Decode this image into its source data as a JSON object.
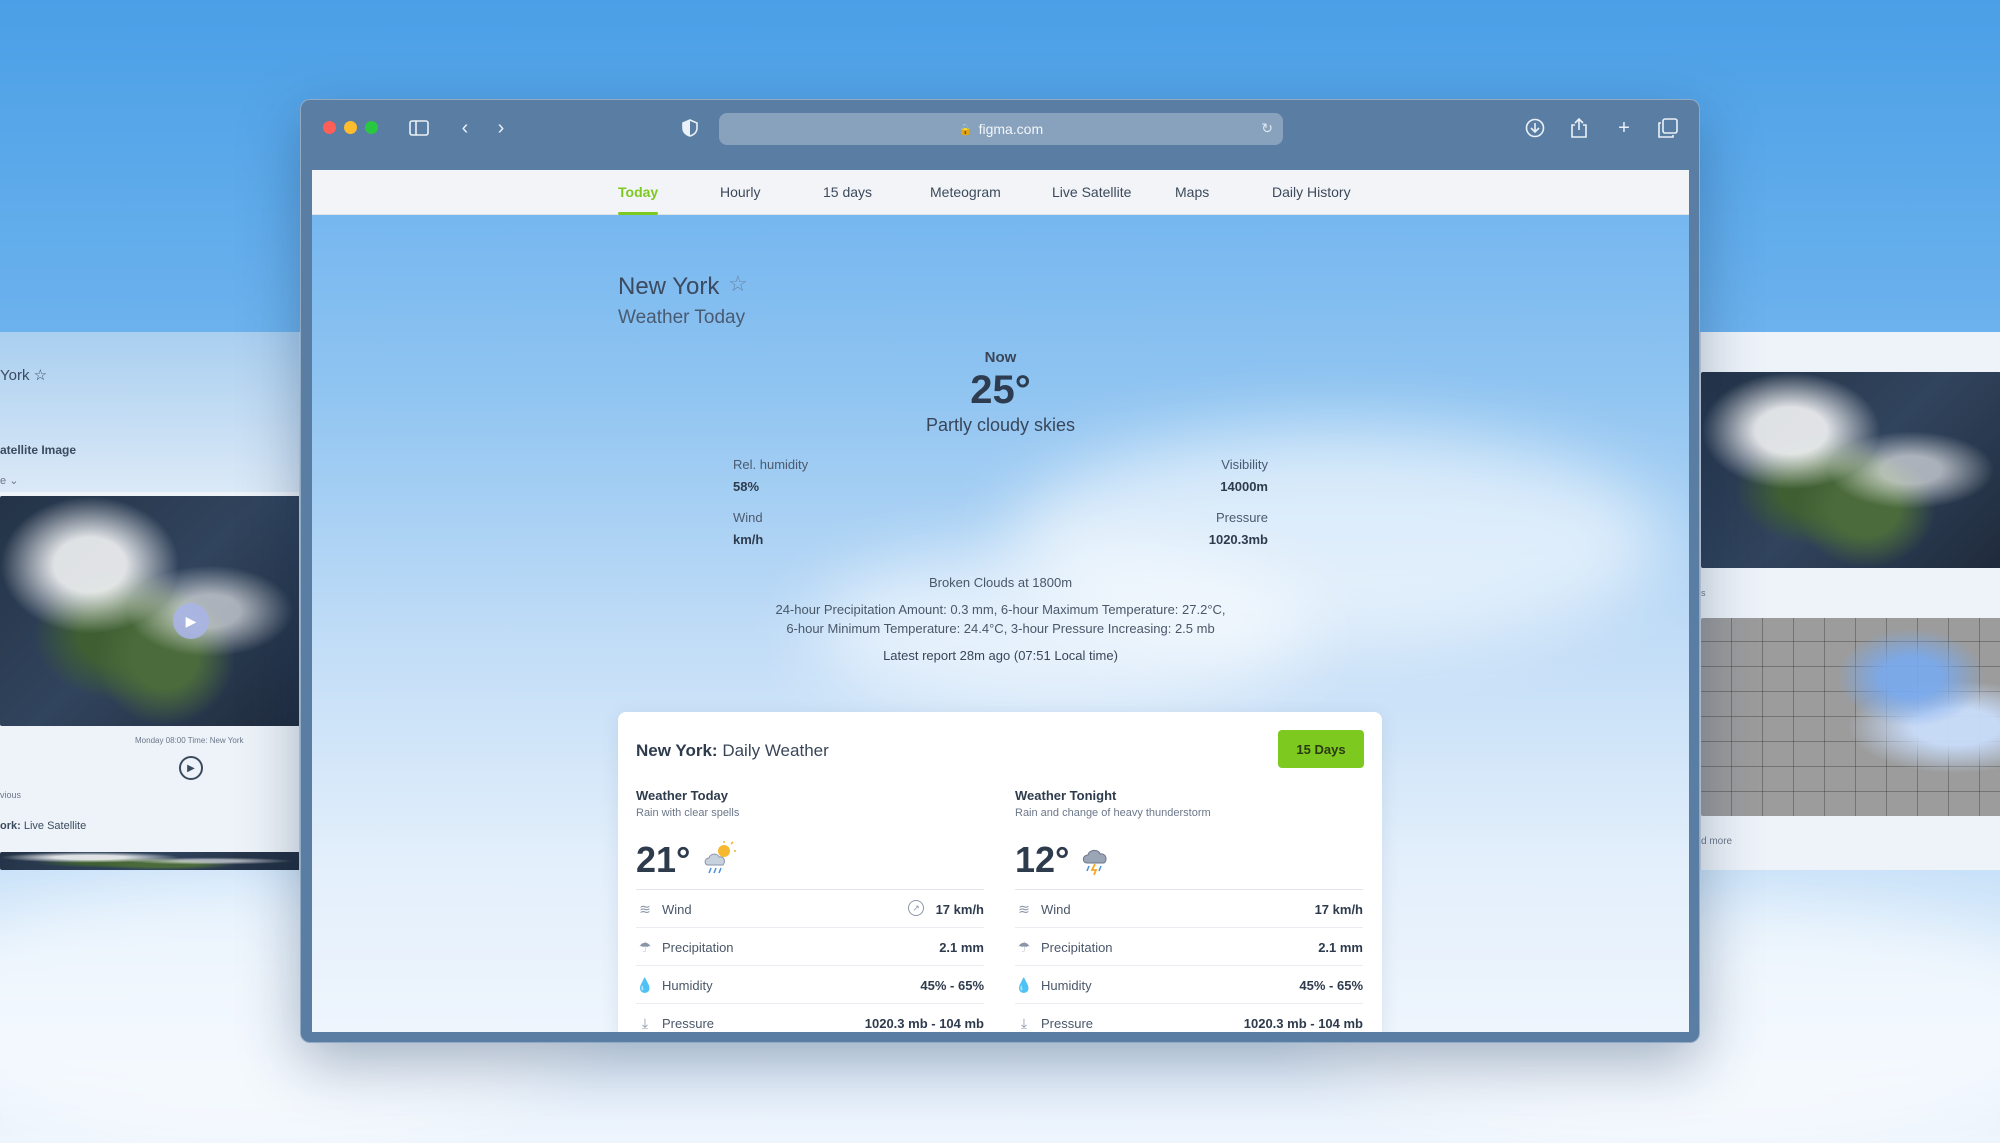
{
  "browser": {
    "url": "figma.com"
  },
  "nav": {
    "items": [
      "Today",
      "Hourly",
      "15 days",
      "Meteogram",
      "Live Satellite",
      "Maps",
      "Daily History"
    ],
    "active": "Today"
  },
  "header": {
    "city": "New York",
    "subtitle": "Weather Today"
  },
  "now": {
    "label": "Now",
    "temp": "25°",
    "condition": "Partly cloudy skies",
    "humidity_label": "Rel. humidity",
    "humidity_value": "58%",
    "wind_label": "Wind",
    "wind_value": "km/h",
    "visibility_label": "Visibility",
    "visibility_value": "14000m",
    "pressure_label": "Pressure",
    "pressure_value": "1020.3mb",
    "clouds": "Broken Clouds at 1800m",
    "details_1": "24-hour Precipitation Amount: 0.3 mm, 6-hour Maximum Temperature: 27.2°C,",
    "details_2": "6-hour Minimum Temperature: 24.4°C, 3-hour Pressure Increasing: 2.5 mb",
    "report": "Latest report 28m ago (07:51 Local time)"
  },
  "card": {
    "city": "New York:",
    "title": "Daily Weather",
    "button": "15 Days",
    "today": {
      "title": "Weather Today",
      "subtitle": "Rain with clear spells",
      "temp": "21°",
      "rows": [
        {
          "label": "Wind",
          "value": "17 km/h"
        },
        {
          "label": "Precipitation",
          "value": "2.1 mm"
        },
        {
          "label": "Humidity",
          "value": "45% - 65%"
        },
        {
          "label": "Pressure",
          "value": "1020.3 mb - 104 mb"
        }
      ]
    },
    "tonight": {
      "title": "Weather Tonight",
      "subtitle": "Rain and change of heavy thunderstorm",
      "temp": "12°",
      "rows": [
        {
          "label": "Wind",
          "value": "17 km/h"
        },
        {
          "label": "Precipitation",
          "value": "2.1 mm"
        },
        {
          "label": "Humidity",
          "value": "45% - 65%"
        },
        {
          "label": "Pressure",
          "value": "1020.3 mb - 104 mb"
        }
      ]
    }
  },
  "side_left": {
    "city": "York",
    "heading": "atellite Image",
    "select": "e",
    "caption": "Monday 08:00 Time: New York",
    "prev": "vious",
    "footer_city": "ork:",
    "footer_label": "Live Satellite"
  },
  "side_right": {
    "caption": "s",
    "more": "d more"
  },
  "colors": {
    "accent": "#7dc91f",
    "text": "#2e3b4d"
  }
}
